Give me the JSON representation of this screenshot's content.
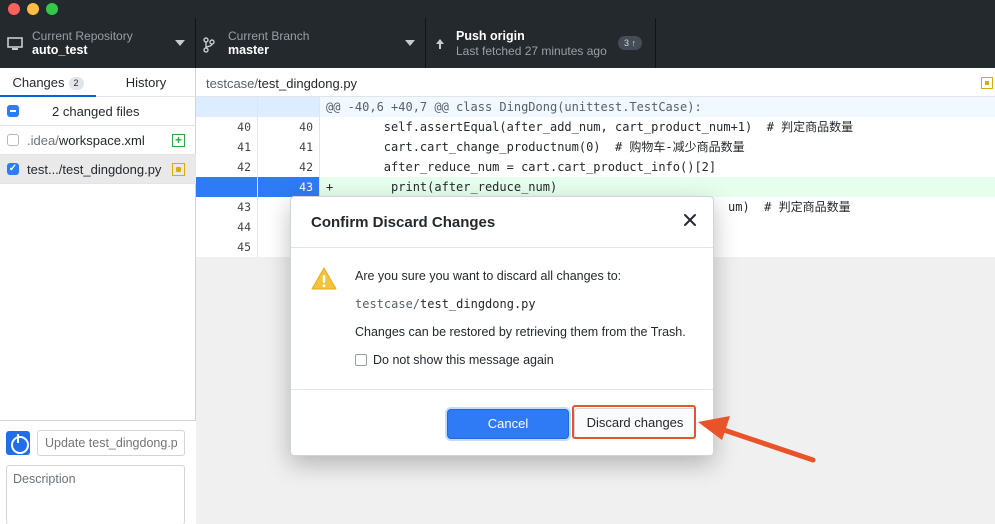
{
  "toolbar": {
    "repo_title": "Current Repository",
    "repo_value": "auto_test",
    "branch_title": "Current Branch",
    "branch_value": "master",
    "push_title": "Push origin",
    "push_subtitle": "Last fetched 27 minutes ago",
    "push_badge": "3 ↑"
  },
  "sidebar": {
    "tabs": [
      {
        "label": "Changes",
        "count": "2",
        "active": true
      },
      {
        "label": "History",
        "active": false
      }
    ],
    "files_header": "2 changed files",
    "files": [
      {
        "dir": ".idea/",
        "name": "workspace.xml",
        "checked": false,
        "status": "added"
      },
      {
        "dir": "test.../",
        "name": "test_dingdong.py",
        "checked": true,
        "status": "modified"
      }
    ],
    "summary_placeholder": "Update test_dingdong.py",
    "description_placeholder": "Description"
  },
  "main": {
    "path_dir": "testcase/",
    "path_file": "test_dingdong.py",
    "hunk_header": "@@ -40,6 +40,7 @@ class DingDong(unittest.TestCase):",
    "lines": [
      {
        "old": "40",
        "new": "40",
        "prefix": " ",
        "code": "        self.assertEqual(after_add_num, cart_product_num+1)  # 判定商品数量"
      },
      {
        "old": "41",
        "new": "41",
        "prefix": " ",
        "code": "        cart.cart_change_productnum(0)  # 购物车-减少商品数量"
      },
      {
        "old": "42",
        "new": "42",
        "prefix": " ",
        "code": "        after_reduce_num = cart.cart_product_info()[2]"
      },
      {
        "old": "",
        "new": "43",
        "prefix": "+",
        "code": "        print(after_reduce_num)"
      },
      {
        "old": "43",
        "new": "",
        "prefix": " ",
        "code": "um)  # 判定商品数量"
      },
      {
        "old": "44",
        "new": "",
        "prefix": " ",
        "code": ""
      },
      {
        "old": "45",
        "new": "",
        "prefix": " ",
        "code": ""
      }
    ]
  },
  "dialog": {
    "title": "Confirm Discard Changes",
    "message": "Are you sure you want to discard all changes to:",
    "file_dir": "testcase/",
    "file_name": "test_dingdong.py",
    "restore_note": "Changes can be restored by retrieving them from the Trash.",
    "checkbox_label": "Do not show this message again",
    "cancel_label": "Cancel",
    "discard_label": "Discard changes"
  },
  "colors": {
    "accent": "#2f7bf6",
    "annotation": "#e8532a",
    "added_bg": "#e6ffed",
    "warning": "#f5c33b"
  }
}
